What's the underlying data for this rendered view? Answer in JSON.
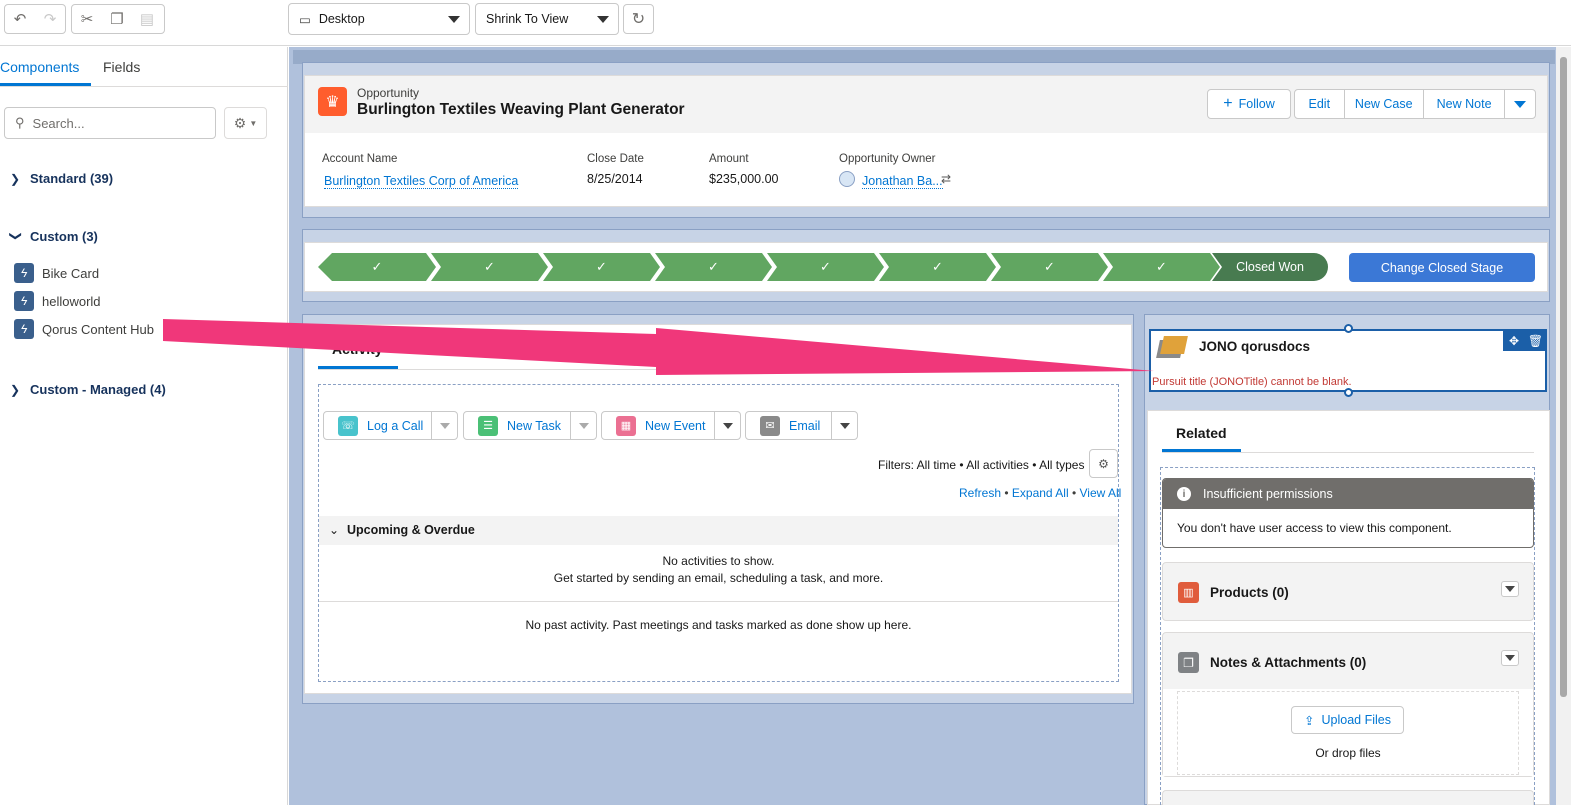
{
  "toolbar": {
    "device_select": "Desktop",
    "zoom_select": "Shrink To View"
  },
  "sidebar": {
    "tabs": [
      "Components",
      "Fields"
    ],
    "search_placeholder": "Search...",
    "sections": {
      "standard": "Standard (39)",
      "custom": "Custom (3)",
      "custom_managed": "Custom - Managed (4)"
    },
    "custom_items": [
      "Bike Card",
      "helloworld",
      "Qorus Content Hub"
    ]
  },
  "highlights": {
    "object_label": "Opportunity",
    "record_name": "Burlington Textiles Weaving Plant Generator",
    "actions": [
      "Follow",
      "Edit",
      "New Case",
      "New Note"
    ],
    "fields": {
      "account_label": "Account Name",
      "account_value": "Burlington Textiles Corp of America",
      "close_label": "Close Date",
      "close_value": "8/25/2014",
      "amount_label": "Amount",
      "amount_value": "$235,000.00",
      "owner_label": "Opportunity Owner",
      "owner_value": "Jonathan Ba..."
    }
  },
  "path": {
    "completed_steps": 8,
    "current_stage": "Closed Won",
    "button": "Change Closed Stage"
  },
  "activity": {
    "tab_active": "Activity",
    "buttons": [
      "Log a Call",
      "New Task",
      "New Event",
      "Email"
    ],
    "filters": "Filters: All time • All activities • All types",
    "links": [
      "Refresh",
      "Expand All",
      "View All"
    ],
    "upcoming_header": "Upcoming & Overdue",
    "no_activity_1": "No activities to show.",
    "no_activity_2": "Get started by sending an email, scheduling a task, and more.",
    "no_past": "No past activity. Past meetings and tasks marked as done show up here."
  },
  "qorus": {
    "title": "JONO qorusdocs",
    "error": "Pursuit title (JONOTitle) cannot be blank."
  },
  "related": {
    "tab": "Related",
    "insufficient_title": "Insufficient permissions",
    "insufficient_body": "You don't have user access to view this component.",
    "products": "Products (0)",
    "notes": "Notes & Attachments (0)",
    "upload": "Upload Files",
    "drop": "Or drop files"
  },
  "colors": {
    "accent": "#0176d3",
    "path_green": "#61a661",
    "path_won": "#487b50",
    "stage_button": "#3b78d6",
    "annotation_arrow": "#f0377a",
    "error_text": "#c23934"
  }
}
